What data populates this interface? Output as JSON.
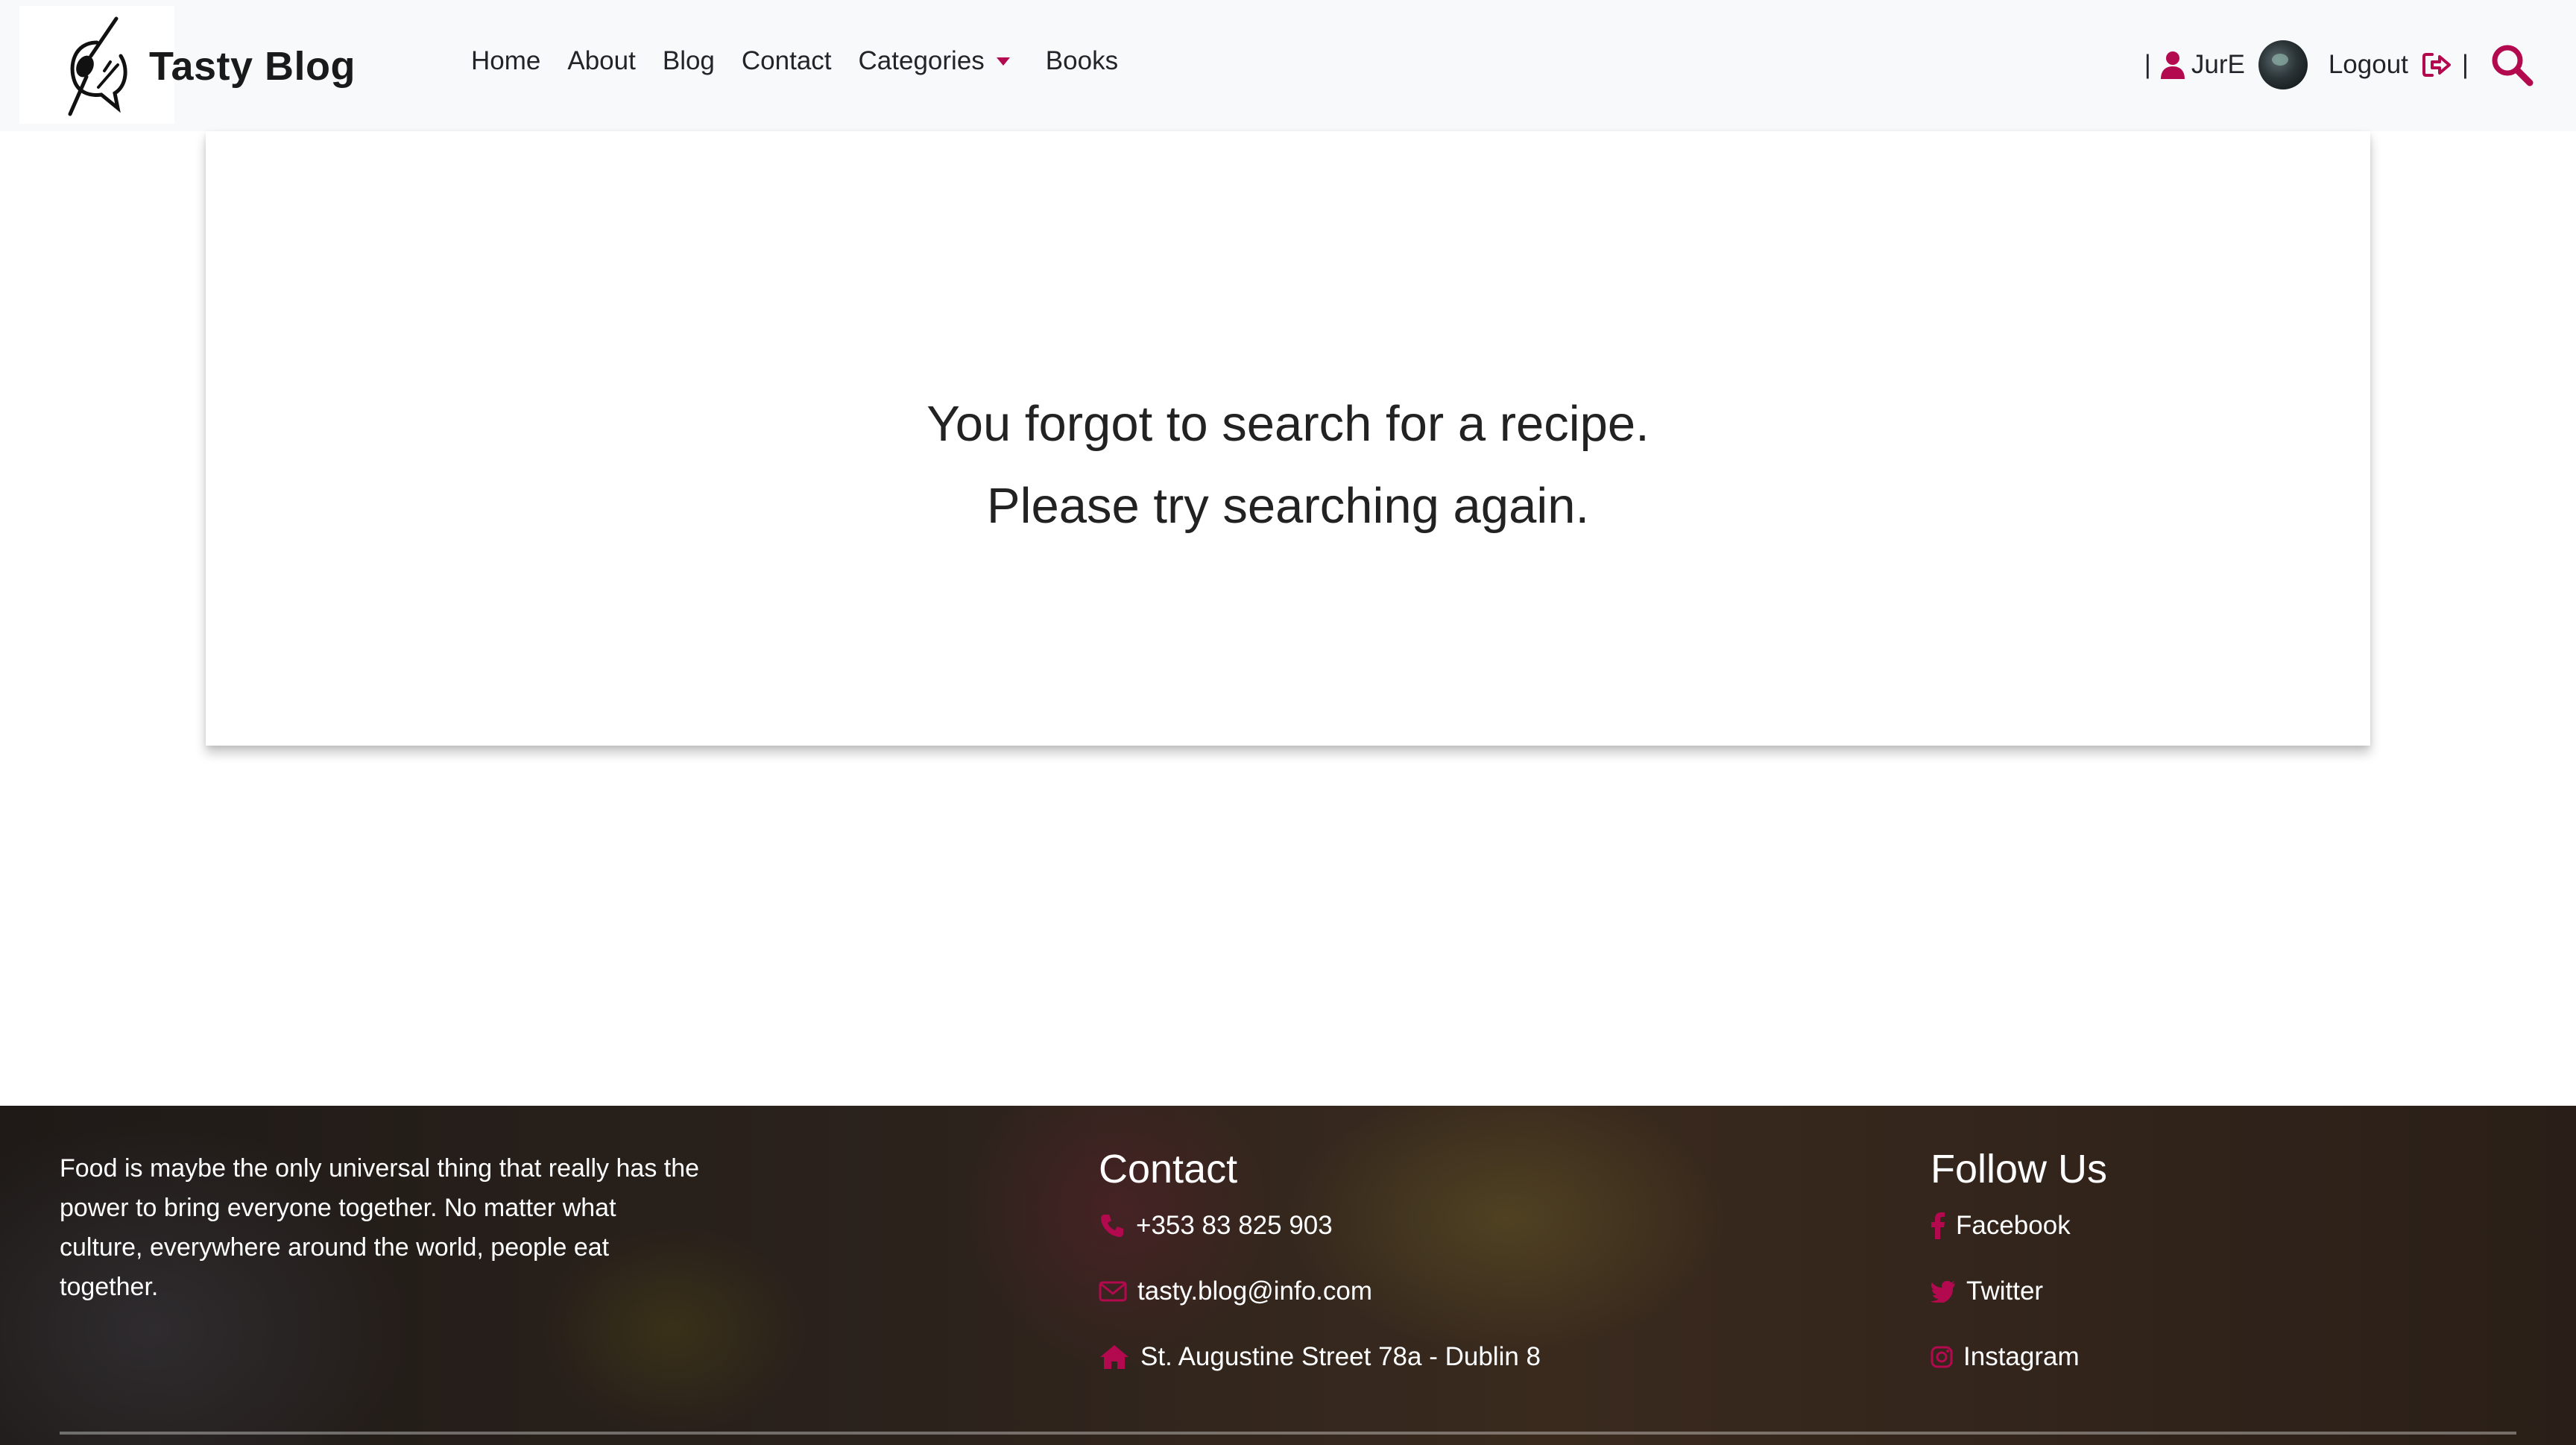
{
  "brand": {
    "name": "Tasty Blog"
  },
  "nav": {
    "links": [
      "Home",
      "About",
      "Blog",
      "Contact",
      "Categories",
      "Books"
    ]
  },
  "user": {
    "pipe_left": "|",
    "username": "JurE",
    "logout_label": "Logout",
    "pipe_right": "|"
  },
  "message": {
    "line1": "You forgot to search for a recipe.",
    "line2": "Please try searching again."
  },
  "footer": {
    "about": "Food is maybe the only universal thing that really has the power to bring everyone together. No matter what culture, everywhere around the world, people eat together.",
    "contact": {
      "title": "Contact",
      "phone": "+353 83 825 903",
      "email": "tasty.blog@info.com",
      "address": "St. Augustine Street 78a - Dublin 8"
    },
    "follow": {
      "title": "Follow Us",
      "facebook": "Facebook",
      "twitter": "Twitter",
      "instagram": "Instagram"
    }
  },
  "colors": {
    "accent": "#b3094f",
    "navbar_bg": "#f8f9fa",
    "text": "#212529"
  }
}
